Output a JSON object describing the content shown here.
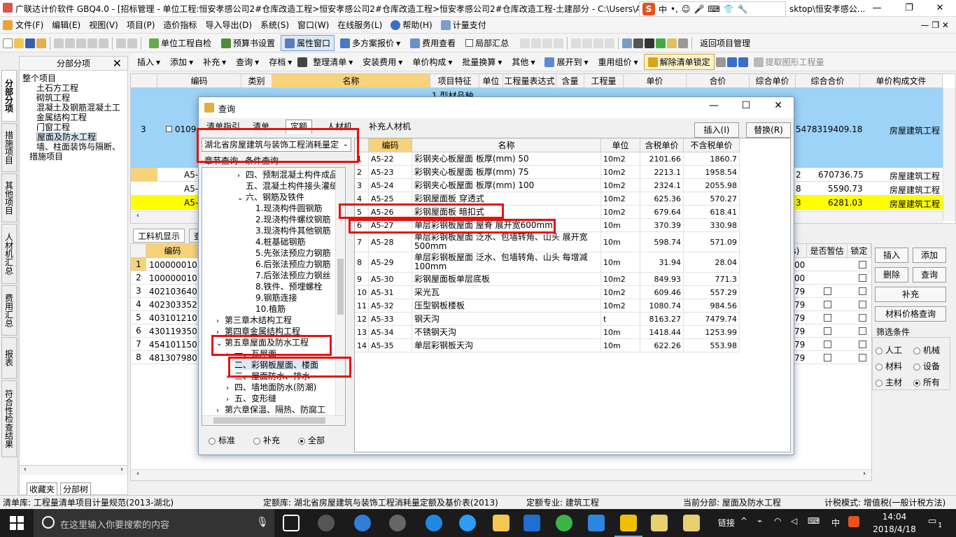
{
  "window": {
    "title": "广联达计价软件 GBQ4.0 - [招标管理 - 单位工程:恒安孝感公司2#仓库改造工程>恒安孝感公司2#仓库改造工程>恒安孝感公司2#仓库改造工程-土建部分 - C:\\Users\\A",
    "title_tail": "sktop\\恒安孝感公..."
  },
  "ime": {
    "logo": "S",
    "items": [
      "中",
      "•,",
      "☺",
      "🎤",
      "⌨",
      "👕",
      "🔧"
    ]
  },
  "menu": [
    "文件(F)",
    "编辑(E)",
    "视图(V)",
    "项目(P)",
    "造价指标",
    "导入导出(D)",
    "系统(S)",
    "窗口(W)",
    "在线服务(L)",
    "帮助(H)",
    "计量支付"
  ],
  "toolbar1": {
    "self_check": "单位工程自检",
    "budget_setting": "预算书设置",
    "property_window": "属性窗口",
    "multi_plan": "多方案报价",
    "fee_view": "费用查看",
    "local_summary": "局部汇总",
    "return_project": "返回项目管理"
  },
  "toolbar2": {
    "insert": "插入",
    "add": "添加",
    "supplement": "补充",
    "query": "查询",
    "store": "存档",
    "organize": "整理清单",
    "install_fee": "安装费用",
    "unit_composition": "单价构成",
    "batch_convert": "批量换算",
    "other": "其他",
    "expand_to": "展开到",
    "reuse": "重用组价",
    "unlock": "解除清单锁定",
    "extract": "提取图形工程量"
  },
  "left_tabs": [
    "分部分项",
    "措施项目",
    "其他项目",
    "人材机汇总",
    "费用汇总",
    "报表",
    "符合性检查结果"
  ],
  "tree_panel": {
    "title": "分部分项",
    "items": [
      "整个项目",
      "土石方工程",
      "砌筑工程",
      "混凝土及钢筋混凝土工",
      "金属结构工程",
      "门窗工程",
      "屋面及防水工程",
      "墙、柱面装饰与隔断、",
      "措施项目"
    ],
    "bottom_tabs": [
      "收藏夹",
      "分部树"
    ]
  },
  "main_grid": {
    "headers": [
      "编码",
      "类别",
      "名称",
      "项目特征",
      "单位",
      "工程量表达式",
      "含量",
      "工程量",
      "单价",
      "合价",
      "综合单价",
      "综合合价",
      "单价构成文件"
    ],
    "rows": [
      {
        "num": "3",
        "code": "0109",
        "feature": "1.型材品种、",
        "total": "5478319409.18",
        "unitfile": "房屋建筑工程"
      },
      {
        "num": "",
        "code": "A5-",
        "feature": "",
        "total": "670736.75",
        "prefix": "2",
        "unitfile": "房屋建筑工程"
      },
      {
        "num": "",
        "code": "A5-",
        "feature": "",
        "total": "5590.73",
        "prefix": "8",
        "unitfile": "房屋建筑工程"
      },
      {
        "num": "",
        "code": "A5-",
        "feature": "",
        "total": "6281.03",
        "prefix": "3",
        "unitfile": "房屋建筑工程"
      }
    ]
  },
  "lower": {
    "tab_active": "工料机显示",
    "tab2": "查",
    "header_code": "编码",
    "header_col": "(s)",
    "header_temp": "是否暂估",
    "header_lock": "锁定",
    "rows": [
      {
        "n": "1",
        "code": "100000010",
        "v": "00"
      },
      {
        "n": "2",
        "code": "100000010",
        "v": "00"
      },
      {
        "n": "3",
        "code": "402103640",
        "v": "79"
      },
      {
        "n": "4",
        "code": "402303352",
        "v": "79"
      },
      {
        "n": "5",
        "code": "403101210",
        "v": "79"
      },
      {
        "n": "6",
        "code": "430119350",
        "v": "79"
      },
      {
        "n": "7",
        "code": "454101150",
        "v": "79"
      },
      {
        "n": "8",
        "code": "481307980",
        "v": "79"
      }
    ]
  },
  "side_buttons": {
    "insert": "插入",
    "add": "添加",
    "delete": "删除",
    "query": "查询",
    "supplement": "补充",
    "price_query": "材料价格查询",
    "filter_title": "筛选条件",
    "f_labor": "人工",
    "f_machine": "机械",
    "f_material": "材料",
    "f_equipment": "设备",
    "f_main": "主材",
    "f_all": "所有"
  },
  "dialog": {
    "title": "查询",
    "tabs": [
      "清单指引",
      "清单",
      "定额",
      "人材机",
      "补充人材机"
    ],
    "active_tab": "定额",
    "insert_btn": "插入(I)",
    "replace_btn": "替换(R)",
    "quota_library": "湖北省房屋建筑与装饰工程消耗量定",
    "sub_tabs": [
      "章节查询",
      "条件查询"
    ],
    "tree": [
      {
        "label": "四、预制混凝土构件成品",
        "indent": 3,
        "arrow": ">"
      },
      {
        "label": "五、混凝土构件接头灌缝",
        "indent": 3,
        "arrow": ""
      },
      {
        "label": "六、钢筋及铁件",
        "indent": 3,
        "arrow": "v"
      },
      {
        "label": "1.现浇构件圆钢筋",
        "indent": 4,
        "arrow": ""
      },
      {
        "label": "2.现浇构件螺纹钢筋",
        "indent": 4,
        "arrow": ""
      },
      {
        "label": "3.现浇构件其他钢筋",
        "indent": 4,
        "arrow": ""
      },
      {
        "label": "4.桩基础钢筋",
        "indent": 4,
        "arrow": ""
      },
      {
        "label": "5.先张法预应力钢筋",
        "indent": 4,
        "arrow": ""
      },
      {
        "label": "6.后张法预应力钢筋",
        "indent": 4,
        "arrow": ""
      },
      {
        "label": "7.后张法预应力钢丝",
        "indent": 4,
        "arrow": ""
      },
      {
        "label": "8.铁件、预埋螺栓",
        "indent": 4,
        "arrow": ""
      },
      {
        "label": "9.钢筋连接",
        "indent": 4,
        "arrow": ""
      },
      {
        "label": "10.植筋",
        "indent": 4,
        "arrow": ""
      },
      {
        "label": "第三章木结构工程",
        "indent": 1,
        "arrow": ">"
      },
      {
        "label": "第四章金属结构工程",
        "indent": 1,
        "arrow": ">"
      },
      {
        "label": "第五章屋面及防水工程",
        "indent": 1,
        "arrow": "v"
      },
      {
        "label": "一、瓦屋面",
        "indent": 2,
        "arrow": ">"
      },
      {
        "label": "二、彩钢板屋面、楼面",
        "indent": 2,
        "arrow": ""
      },
      {
        "label": "三、屋面防水、排水",
        "indent": 2,
        "arrow": ">"
      },
      {
        "label": "四、墙地面防水(防潮)",
        "indent": 2,
        "arrow": ">"
      },
      {
        "label": "五、变形缝",
        "indent": 2,
        "arrow": ">"
      },
      {
        "label": "第六章保温、隔热、防腐工",
        "indent": 1,
        "arrow": ">"
      }
    ],
    "radios": {
      "standard": "标准",
      "supplement": "补充",
      "all": "全部"
    },
    "grid_headers": [
      "",
      "编码",
      "名称",
      "单位",
      "含税单价",
      "不含税单价"
    ],
    "rows": [
      {
        "n": "1",
        "code": "A5-22",
        "name": "彩钢夹心板屋面 板厚(mm) 50",
        "unit": "10m2",
        "tax": "2101.66",
        "notax": "1860.7"
      },
      {
        "n": "2",
        "code": "A5-23",
        "name": "彩钢夹心板屋面 板厚(mm) 75",
        "unit": "10m2",
        "tax": "2213.1",
        "notax": "1958.54"
      },
      {
        "n": "3",
        "code": "A5-24",
        "name": "彩钢夹心板屋面 板厚(mm) 100",
        "unit": "10m2",
        "tax": "2324.1",
        "notax": "2055.98"
      },
      {
        "n": "4",
        "code": "A5-25",
        "name": "彩钢屋面板 穿透式",
        "unit": "10m2",
        "tax": "625.36",
        "notax": "570.27"
      },
      {
        "n": "5",
        "code": "A5-26",
        "name": "彩钢屋面板 暗扣式",
        "unit": "10m2",
        "tax": "679.64",
        "notax": "618.41"
      },
      {
        "n": "6",
        "code": "A5-27",
        "name": "单层彩钢板屋面 屋脊 展开宽600mm",
        "unit": "10m",
        "tax": "370.39",
        "notax": "330.98"
      },
      {
        "n": "7",
        "code": "A5-28",
        "name": "单层彩钢板屋面 泛水、包墙转角、山头 展开宽500mm",
        "unit": "10m",
        "tax": "598.74",
        "notax": "571.09"
      },
      {
        "n": "8",
        "code": "A5-29",
        "name": "单层彩钢板屋面 泛水、包墙转角、山头 每增减100mm",
        "unit": "10m",
        "tax": "31.94",
        "notax": "28.04"
      },
      {
        "n": "9",
        "code": "A5-30",
        "name": "彩钢屋面板单层底板",
        "unit": "10m2",
        "tax": "849.93",
        "notax": "771.3"
      },
      {
        "n": "10",
        "code": "A5-31",
        "name": "采光瓦",
        "unit": "10m2",
        "tax": "609.46",
        "notax": "557.29"
      },
      {
        "n": "11",
        "code": "A5-32",
        "name": "压型钢板楼板",
        "unit": "10m2",
        "tax": "1080.74",
        "notax": "984.56"
      },
      {
        "n": "12",
        "code": "A5-33",
        "name": "钢天沟",
        "unit": "t",
        "tax": "8163.27",
        "notax": "7479.74"
      },
      {
        "n": "13",
        "code": "A5-34",
        "name": "不锈钢天沟",
        "unit": "10m",
        "tax": "1418.44",
        "notax": "1253.99"
      },
      {
        "n": "14",
        "code": "A5-35",
        "name": "单层彩钢板天沟",
        "unit": "10m",
        "tax": "622.26",
        "notax": "553.98"
      }
    ]
  },
  "status": {
    "list_lib": "清单库: 工程量清单项目计量规范(2013-湖北)",
    "quota_lib": "定额库: 湖北省房屋建筑与装饰工程消耗量定额及基价表(2013)",
    "specialty": "定额专业: 建筑工程",
    "current": "当前分部: 屋面及防水工程",
    "mode": "计税模式: 增值税(一般计税方法)"
  },
  "taskbar": {
    "search_placeholder": "在这里输入你要搜索的内容",
    "link": "链接",
    "lang": "中",
    "time": "14:04",
    "date": "2018/4/18",
    "notify": "1"
  },
  "colors": {
    "accent": "#7a9cc6",
    "highlight_row": "#ffff00",
    "selected_blue": "#9cd3f7",
    "red_box": "#e81010"
  }
}
